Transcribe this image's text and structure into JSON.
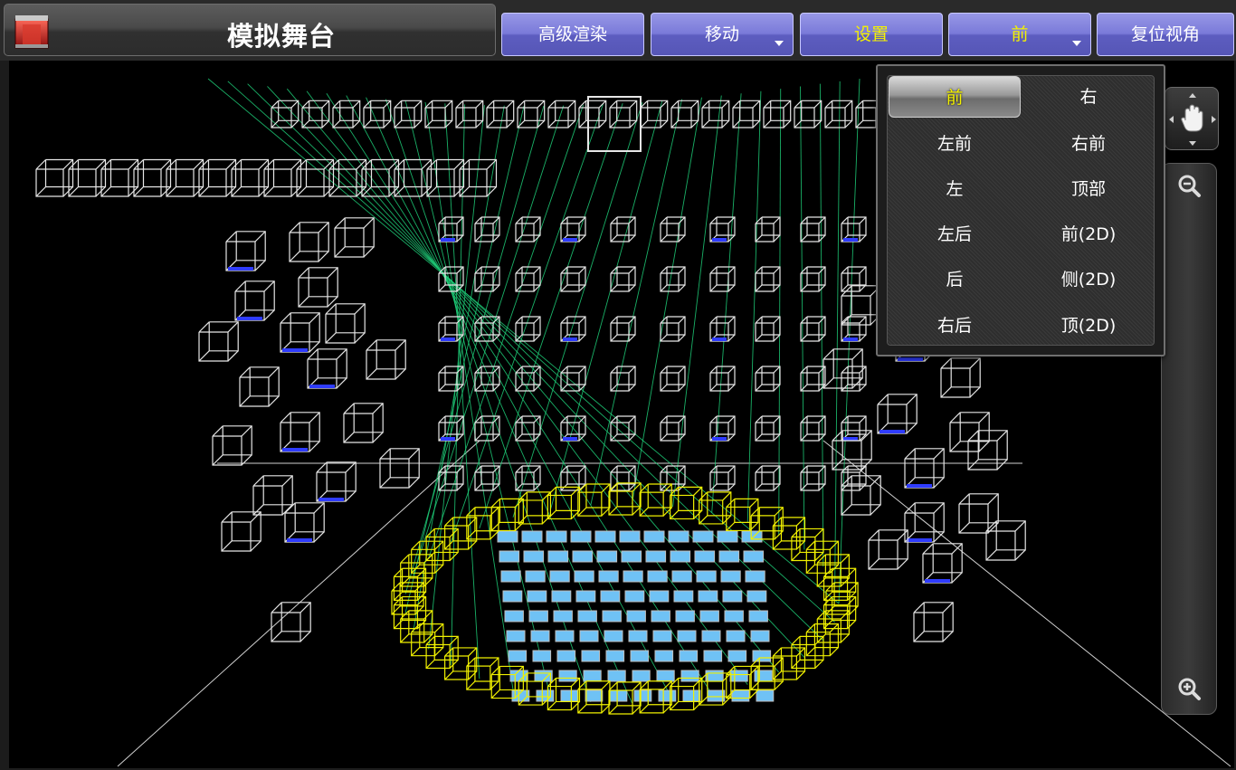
{
  "app": {
    "title": "模拟舞台",
    "logo_icon": "stage-logo-icon"
  },
  "toolbar": {
    "buttons": [
      {
        "label": "高级渲染",
        "active": false,
        "dropdown": false
      },
      {
        "label": "移动",
        "active": false,
        "dropdown": true
      },
      {
        "label": "设置",
        "active": true,
        "dropdown": false
      },
      {
        "label": "前",
        "active": true,
        "dropdown": true
      },
      {
        "label": "复位视角",
        "active": false,
        "dropdown": false
      }
    ]
  },
  "view_menu": {
    "selected": "前",
    "items": [
      "前",
      "右",
      "左前",
      "右前",
      "左",
      "顶部",
      "左后",
      "前(2D)",
      "后",
      "侧(2D)",
      "右后",
      "顶(2D)"
    ]
  },
  "nav_controls": {
    "pan_icon": "hand-pan-icon",
    "zoom_out_icon": "zoom-out-icon",
    "zoom_in_icon": "zoom-in-icon"
  },
  "colors": {
    "button_blue": "#7a7ad9",
    "active_text": "#f5f200",
    "beam_green": "#1fd07a",
    "fixture_white": "#e6e6e6",
    "fixture_yellow": "#f0f000",
    "lens_blue": "#2f3cff",
    "floor_light_blue": "#6fc2f5"
  }
}
